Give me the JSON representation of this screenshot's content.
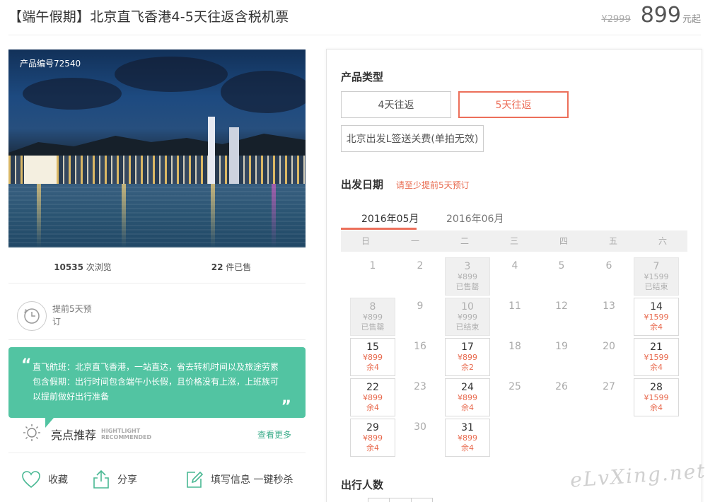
{
  "product": {
    "title": "【端午假期】北京直飞香港4-5天往返含税机票",
    "old_price": "¥2999",
    "price": "899",
    "price_unit": "元起",
    "code": "产品编号72540"
  },
  "stats": {
    "views": "10535",
    "views_label": "次浏览",
    "sold": "22",
    "sold_label": "件已售"
  },
  "advance": {
    "text": "提前5天预订"
  },
  "highlight": {
    "line1": "直飞航班：北京直飞香港，一站直达，省去转机时间以及旅途劳累",
    "line2": "包含假期：出行时间包含端午小长假，且价格没有上涨，上班族可",
    "line3": "以提前做好出行准备",
    "title": "亮点推荐",
    "sub1": "HIGHTLIGHT",
    "sub2": "RECOMMENDED",
    "more": "查看更多"
  },
  "actions": {
    "favorite": "收藏",
    "share": "分享",
    "fill": "填写信息 一键秒杀"
  },
  "booking": {
    "type_title": "产品类型",
    "types": [
      "4天往返",
      "5天往返",
      "北京出发L签送关费(单拍无效)"
    ],
    "active_type": "5天往返",
    "date_title": "出发日期",
    "date_note": "请至少提前5天预订",
    "months": [
      "2016年05月",
      "2016年06月"
    ],
    "active_month": "2016年05月",
    "weekdays": [
      "日",
      "一",
      "二",
      "三",
      "四",
      "五",
      "六"
    ],
    "people_title": "出行人数"
  },
  "calendar": [
    {
      "day": "1"
    },
    {
      "day": "2"
    },
    {
      "day": "3",
      "price": "¥899",
      "status": "已售罄"
    },
    {
      "day": "4"
    },
    {
      "day": "5"
    },
    {
      "day": "6"
    },
    {
      "day": "7",
      "price": "¥1599",
      "status": "已结束"
    },
    {
      "day": "8",
      "price": "¥899",
      "status": "已售罄"
    },
    {
      "day": "9"
    },
    {
      "day": "10",
      "price": "¥999",
      "status": "已结束"
    },
    {
      "day": "11"
    },
    {
      "day": "12"
    },
    {
      "day": "13"
    },
    {
      "day": "14",
      "price": "¥1599",
      "status": "余4"
    },
    {
      "day": "15",
      "price": "¥899",
      "status": "余4"
    },
    {
      "day": "16"
    },
    {
      "day": "17",
      "price": "¥899",
      "status": "余2"
    },
    {
      "day": "18"
    },
    {
      "day": "19"
    },
    {
      "day": "20"
    },
    {
      "day": "21",
      "price": "¥1599",
      "status": "余4"
    },
    {
      "day": "22",
      "price": "¥899",
      "status": "余4"
    },
    {
      "day": "23"
    },
    {
      "day": "24",
      "price": "¥899",
      "status": "余4"
    },
    {
      "day": "25"
    },
    {
      "day": "26"
    },
    {
      "day": "27"
    },
    {
      "day": "28",
      "price": "¥1599",
      "status": "余4"
    },
    {
      "day": "29",
      "price": "¥899",
      "status": "余4"
    },
    {
      "day": "30"
    },
    {
      "day": "31",
      "price": "¥899",
      "status": "余4"
    }
  ],
  "watermark": "eLvXing.net",
  "colors": {
    "accent": "#ec6f5a",
    "highlight_bg": "#52c4a2",
    "available_price": "#e8694d"
  }
}
